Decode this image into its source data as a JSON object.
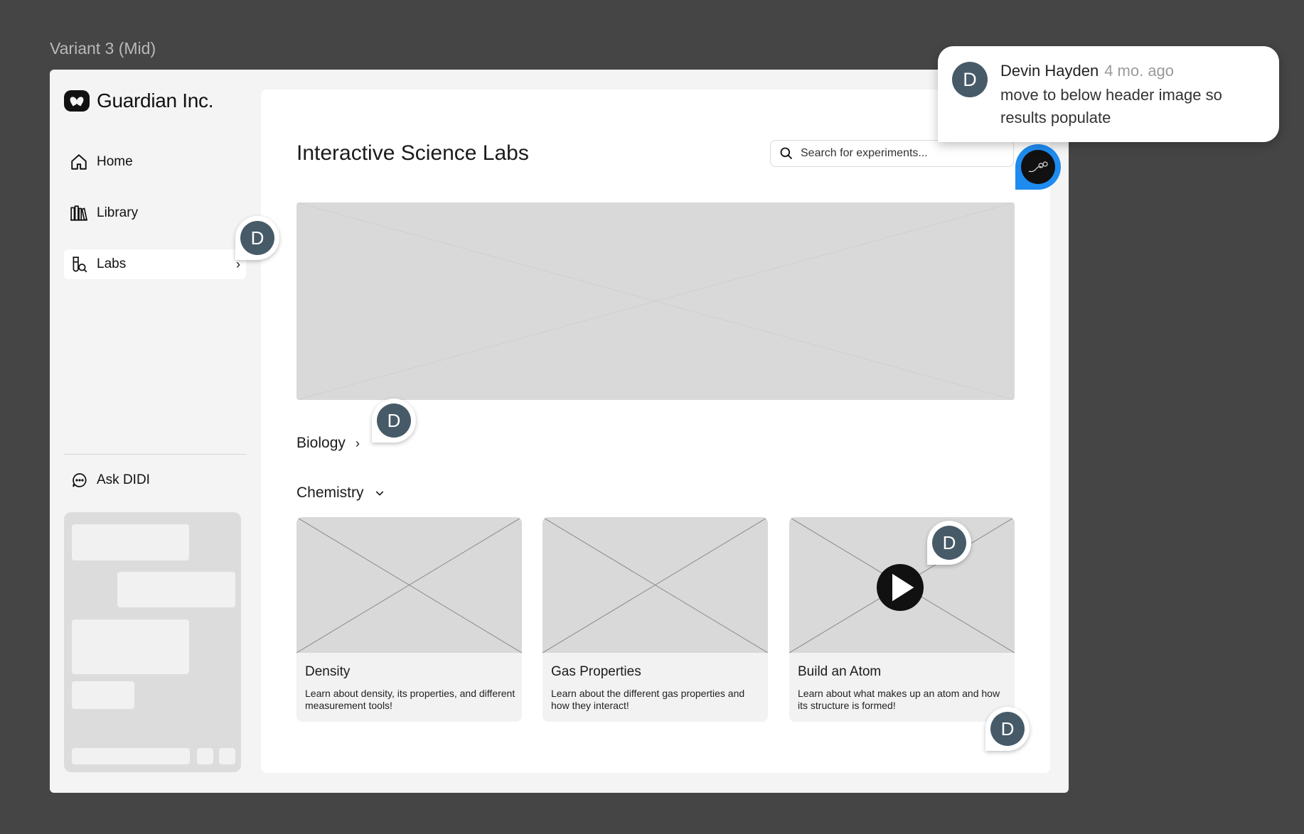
{
  "variant_title": "Variant 3 (Mid)",
  "sidebar": {
    "logo_text": "Guardian Inc.",
    "items": [
      {
        "label": "Home",
        "icon": "home-icon"
      },
      {
        "label": "Library",
        "icon": "library-icon"
      },
      {
        "label": "Labs",
        "icon": "labs-icon",
        "active": true
      }
    ],
    "ask_label": "Ask DIDI"
  },
  "main": {
    "title": "Interactive Science Labs",
    "search_placeholder": "Search for experiments...",
    "sections": [
      {
        "label": "Biology",
        "state": "collapsed"
      },
      {
        "label": "Chemistry",
        "state": "expanded"
      }
    ],
    "cards": [
      {
        "title": "Density",
        "description": "Learn about density, its properties, and different measurement tools!"
      },
      {
        "title": "Gas Properties",
        "description": "Learn about the different gas properties and how they interact!"
      },
      {
        "title": "Build an Atom",
        "description": "Learn about what makes up an atom and how its structure is formed!",
        "has_video": true
      }
    ]
  },
  "comment": {
    "avatar_initial": "D",
    "author": "Devin Hayden",
    "time": "4 mo. ago",
    "text": "move to below header image so results populate"
  },
  "pins": {
    "avatar_initial": "D"
  },
  "colors": {
    "background": "#454545",
    "avatar": "#475a68",
    "active_pin": "#1e8bf0"
  }
}
